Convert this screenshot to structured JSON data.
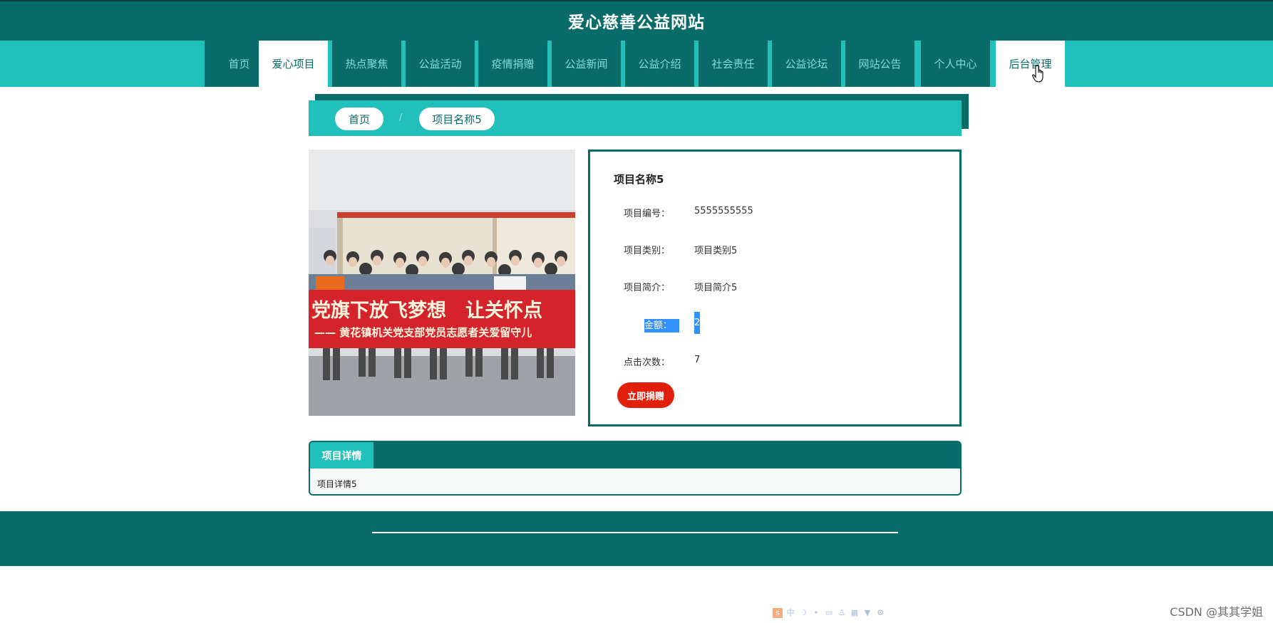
{
  "header": {
    "site_title": "爱心慈善公益网站"
  },
  "nav": {
    "items": [
      {
        "label": "首页"
      },
      {
        "label": "爱心项目"
      },
      {
        "label": "热点聚焦"
      },
      {
        "label": "公益活动"
      },
      {
        "label": "疫情捐赠"
      },
      {
        "label": "公益新闻"
      },
      {
        "label": "公益介绍"
      },
      {
        "label": "社会责任"
      },
      {
        "label": "公益论坛"
      },
      {
        "label": "网站公告"
      },
      {
        "label": "个人中心"
      },
      {
        "label": "后台管理"
      }
    ],
    "active_index": 1,
    "hover_index": 11
  },
  "breadcrumb": {
    "home": "首页",
    "current": "项目名称5"
  },
  "project": {
    "title": "项目名称5",
    "fields": [
      {
        "label": "项目编号：",
        "value": "5555555555"
      },
      {
        "label": "项目类别：",
        "value": "项目类别5"
      },
      {
        "label": "项目简介：",
        "value": "项目简介5"
      },
      {
        "label": "金额：",
        "value": "2",
        "selected": true
      },
      {
        "label": "点击次数：",
        "value": "7"
      }
    ],
    "donate_label": "立即捐赠",
    "photo_banner_line1": "党旗下放飞梦想　让关怀点",
    "photo_banner_line2": "—— 黄花镇机关党支部党员志愿者关爱留守儿"
  },
  "detail": {
    "tab_label": "项目详情",
    "content": "项目详情5"
  },
  "watermark": "CSDN @其其学姐",
  "colors": {
    "primary_dark": "#0a6c68",
    "primary_light": "#22c0ba",
    "donate_red": "#e0200b",
    "selection": "#3390ff"
  }
}
